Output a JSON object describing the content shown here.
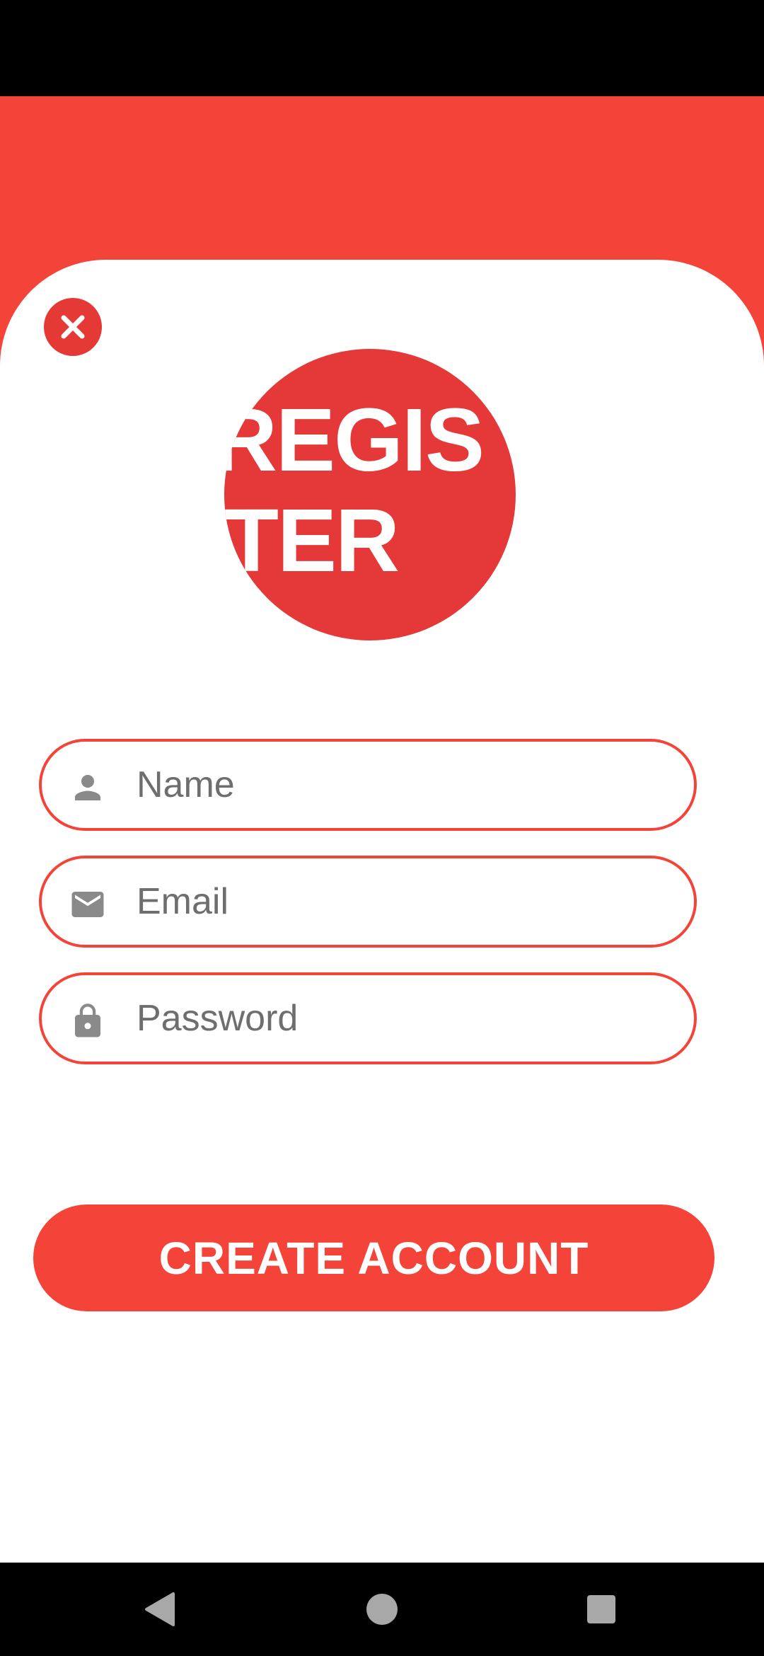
{
  "screen": {
    "title": "REGISTER"
  },
  "form": {
    "name_placeholder": "Name",
    "email_placeholder": "Email",
    "password_placeholder": "Password",
    "submit_label": "CREATE ACCOUNT"
  },
  "icons": {
    "close": "close-icon",
    "name": "person-icon",
    "email": "mail-icon",
    "password": "lock-icon",
    "nav_back": "back-triangle-icon",
    "nav_home": "home-circle-icon",
    "nav_recents": "recents-square-icon"
  },
  "colors": {
    "accent": "#f4443a",
    "title_circle": "#e53838",
    "icon_gray": "#8a8a8a",
    "placeholder_gray": "#6e6e6e"
  }
}
